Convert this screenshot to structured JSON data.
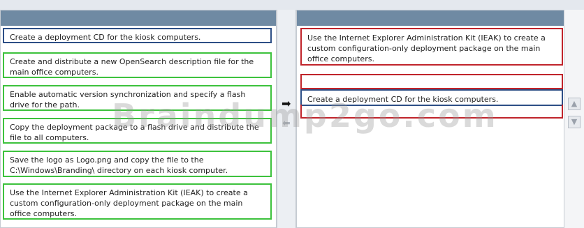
{
  "source_items": [
    {
      "label": "Create a deployment CD for the kiosk computers."
    },
    {
      "label": "Create and distribute a new OpenSearch description file for the main office computers."
    },
    {
      "label": "Enable automatic version synchronization and specify a flash drive for the path."
    },
    {
      "label": "Copy the deployment package to a flash drive and distribute the file to all computers."
    },
    {
      "label": "Save the logo as Logo.png and copy the file to the C:\\Windows\\Branding\\ directory on each kiosk computer."
    },
    {
      "label": "Use the Internet Explorer Administration Kit (IEAK) to create a custom configuration-only deployment package on the main office computers."
    }
  ],
  "answer_slots": [
    {
      "label": "Use the Internet Explorer Administration Kit (IEAK) to create a custom configuration-only deployment package on the main office computers."
    },
    {
      "label": ""
    },
    {
      "label": "Create a deployment CD for the kiosk computers."
    }
  ],
  "controls": {
    "move_right_icon": "arrow-right-icon",
    "move_left_icon": "arrow-left-icon",
    "move_up_icon": "arrow-up-icon",
    "move_down_icon": "arrow-down-icon"
  },
  "watermark": "Braindump2go.com",
  "colors": {
    "header": "#6f8aa3",
    "item_border": "#3dc23d",
    "selected_border": "#2d4f86",
    "slot_border": "#c0242b"
  }
}
